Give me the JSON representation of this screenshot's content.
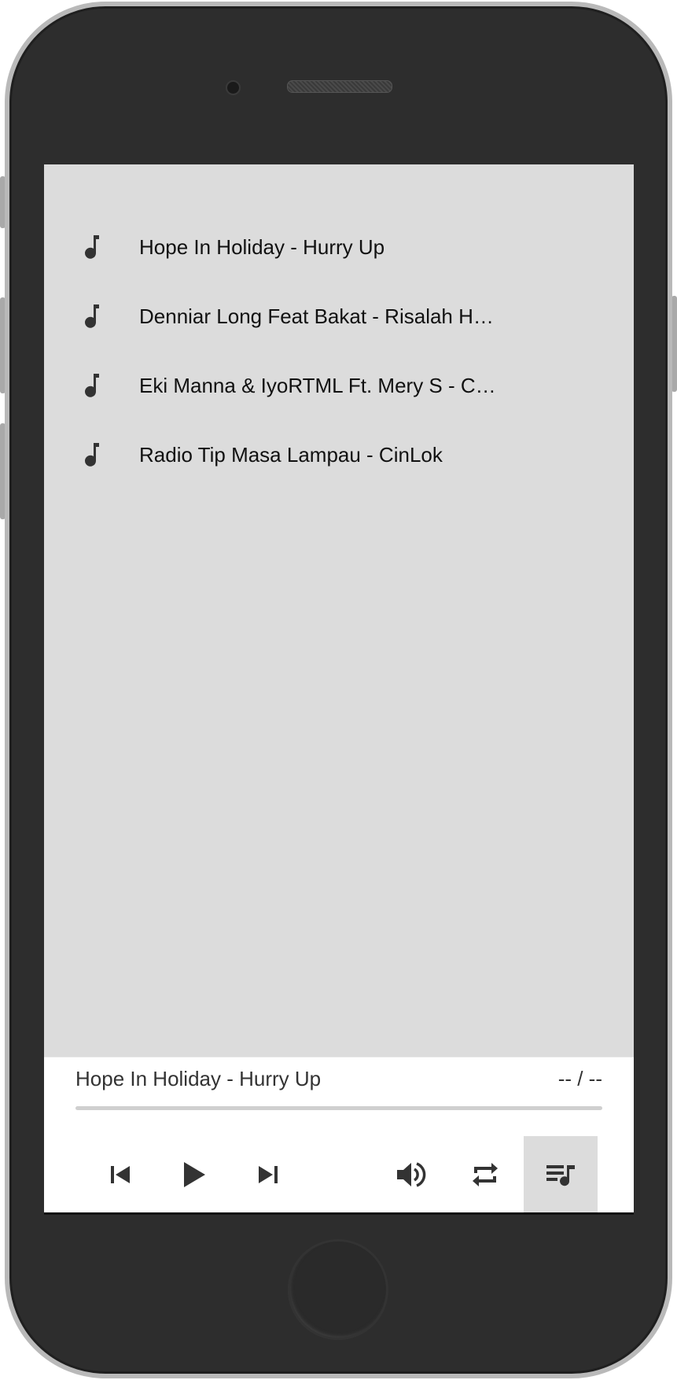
{
  "playlist": {
    "tracks": [
      {
        "title": "Hope In Holiday - Hurry Up",
        "icon": "music-note-icon"
      },
      {
        "title": "Denniar Long Feat Bakat - Risalah H…",
        "icon": "music-note-icon"
      },
      {
        "title": "Eki Manna & IyoRTML Ft. Mery S - C…",
        "icon": "music-note-icon"
      },
      {
        "title": "Radio Tip Masa Lampau - CinLok",
        "icon": "music-note-icon"
      }
    ]
  },
  "player": {
    "now_playing": "Hope In Holiday - Hurry Up",
    "time": "-- / --",
    "progress": 0,
    "controls": {
      "previous": "skip-previous-icon",
      "play": "play-icon",
      "next": "skip-next-icon",
      "volume": "volume-icon",
      "repeat": "repeat-icon",
      "playlist": "playlist-icon"
    }
  },
  "colors": {
    "screen_bg": "#dcdcdc",
    "player_bg": "#ffffff",
    "icon": "#333333",
    "phone_body": "#2d2d2d",
    "phone_rim": "#b9b9b9"
  }
}
